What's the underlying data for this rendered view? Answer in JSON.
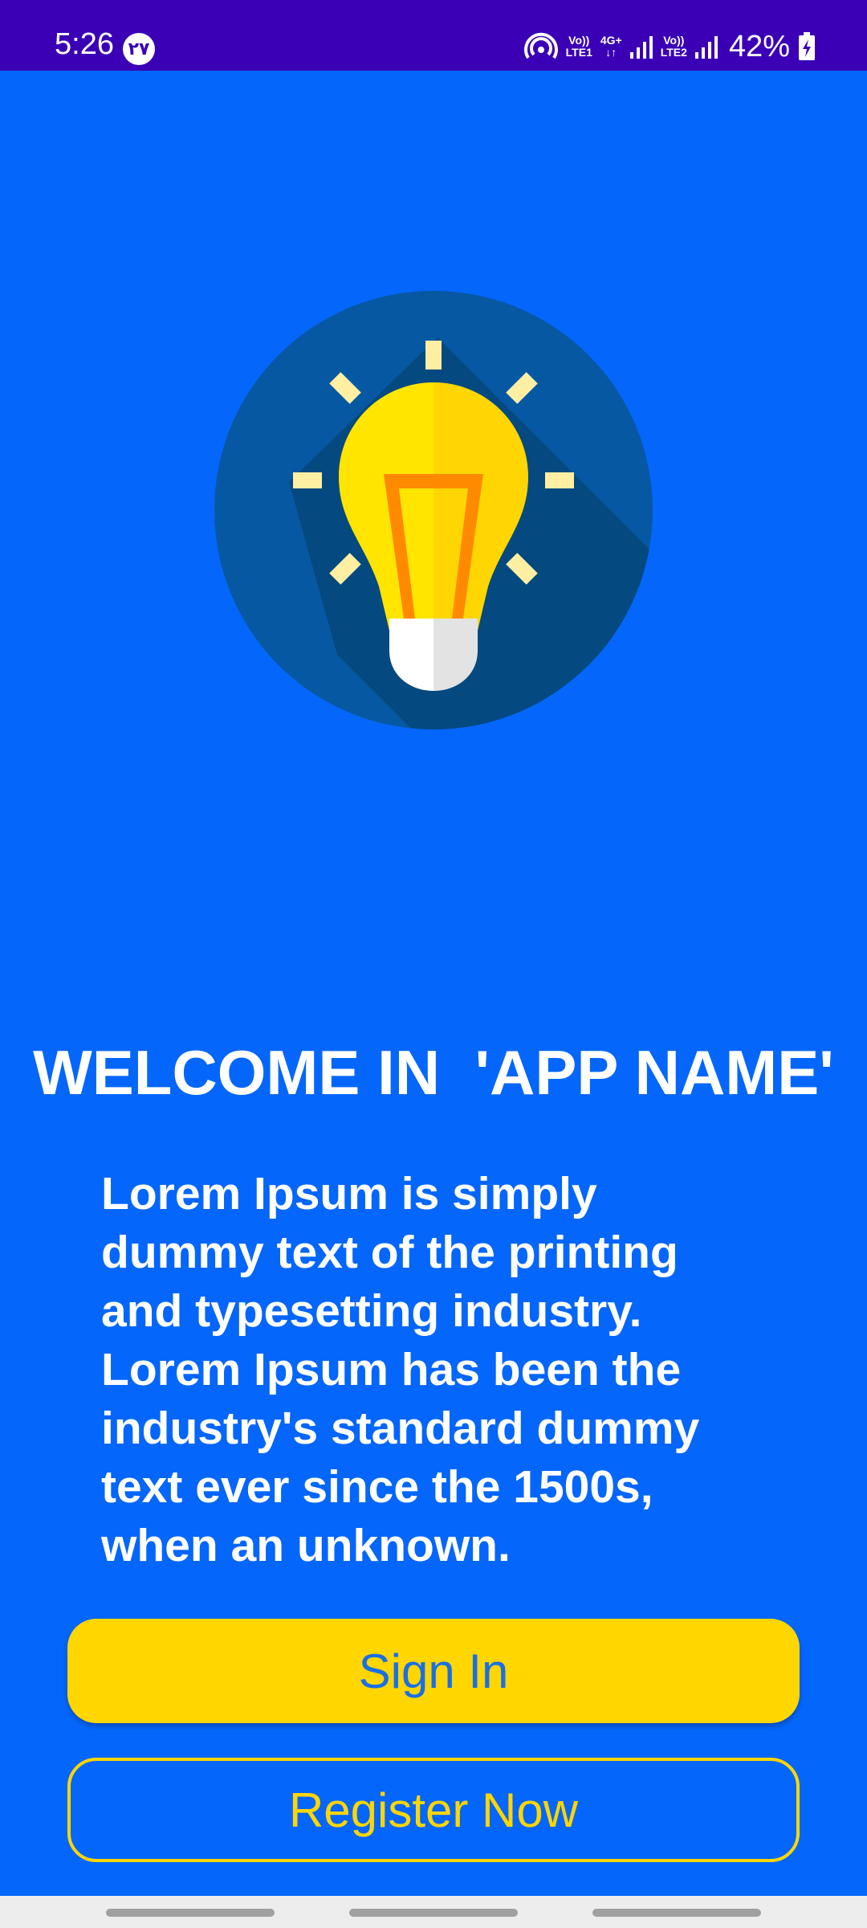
{
  "status_bar": {
    "time": "5:26",
    "notification_badge": "٢٧",
    "sim1_top": "Vo))",
    "sim1_bottom": "LTE1",
    "data_top": "4G+",
    "data_bottom": "↓↑",
    "sim2_top": "Vo))",
    "sim2_bottom": "LTE2",
    "battery": "42%",
    "icons": [
      "hotspot-icon",
      "signal-icon",
      "battery-charging-icon"
    ]
  },
  "hero": {
    "icon": "light-bulb-icon",
    "colors": {
      "circle": "#0758a2",
      "shadow": "#04497f",
      "bulb_left": "#ffe500",
      "bulb_right": "#ffd602",
      "filament": "#ff8a00",
      "rays": "#ffefa3",
      "base": "#ffffff"
    }
  },
  "welcome": {
    "title": "WELCOME IN  'APP NAME'",
    "description": "Lorem Ipsum is simply dummy text of the printing and typesetting industry. Lorem Ipsum has been the industry's standard dummy text ever since the 1500s, when an unknown."
  },
  "actions": {
    "sign_in_label": "Sign In",
    "register_label": "Register Now"
  },
  "theme": {
    "background": "#0466fb",
    "status_bar": "#3b00b5",
    "accent": "#ffd600",
    "button_text": "#1a6fe6"
  }
}
